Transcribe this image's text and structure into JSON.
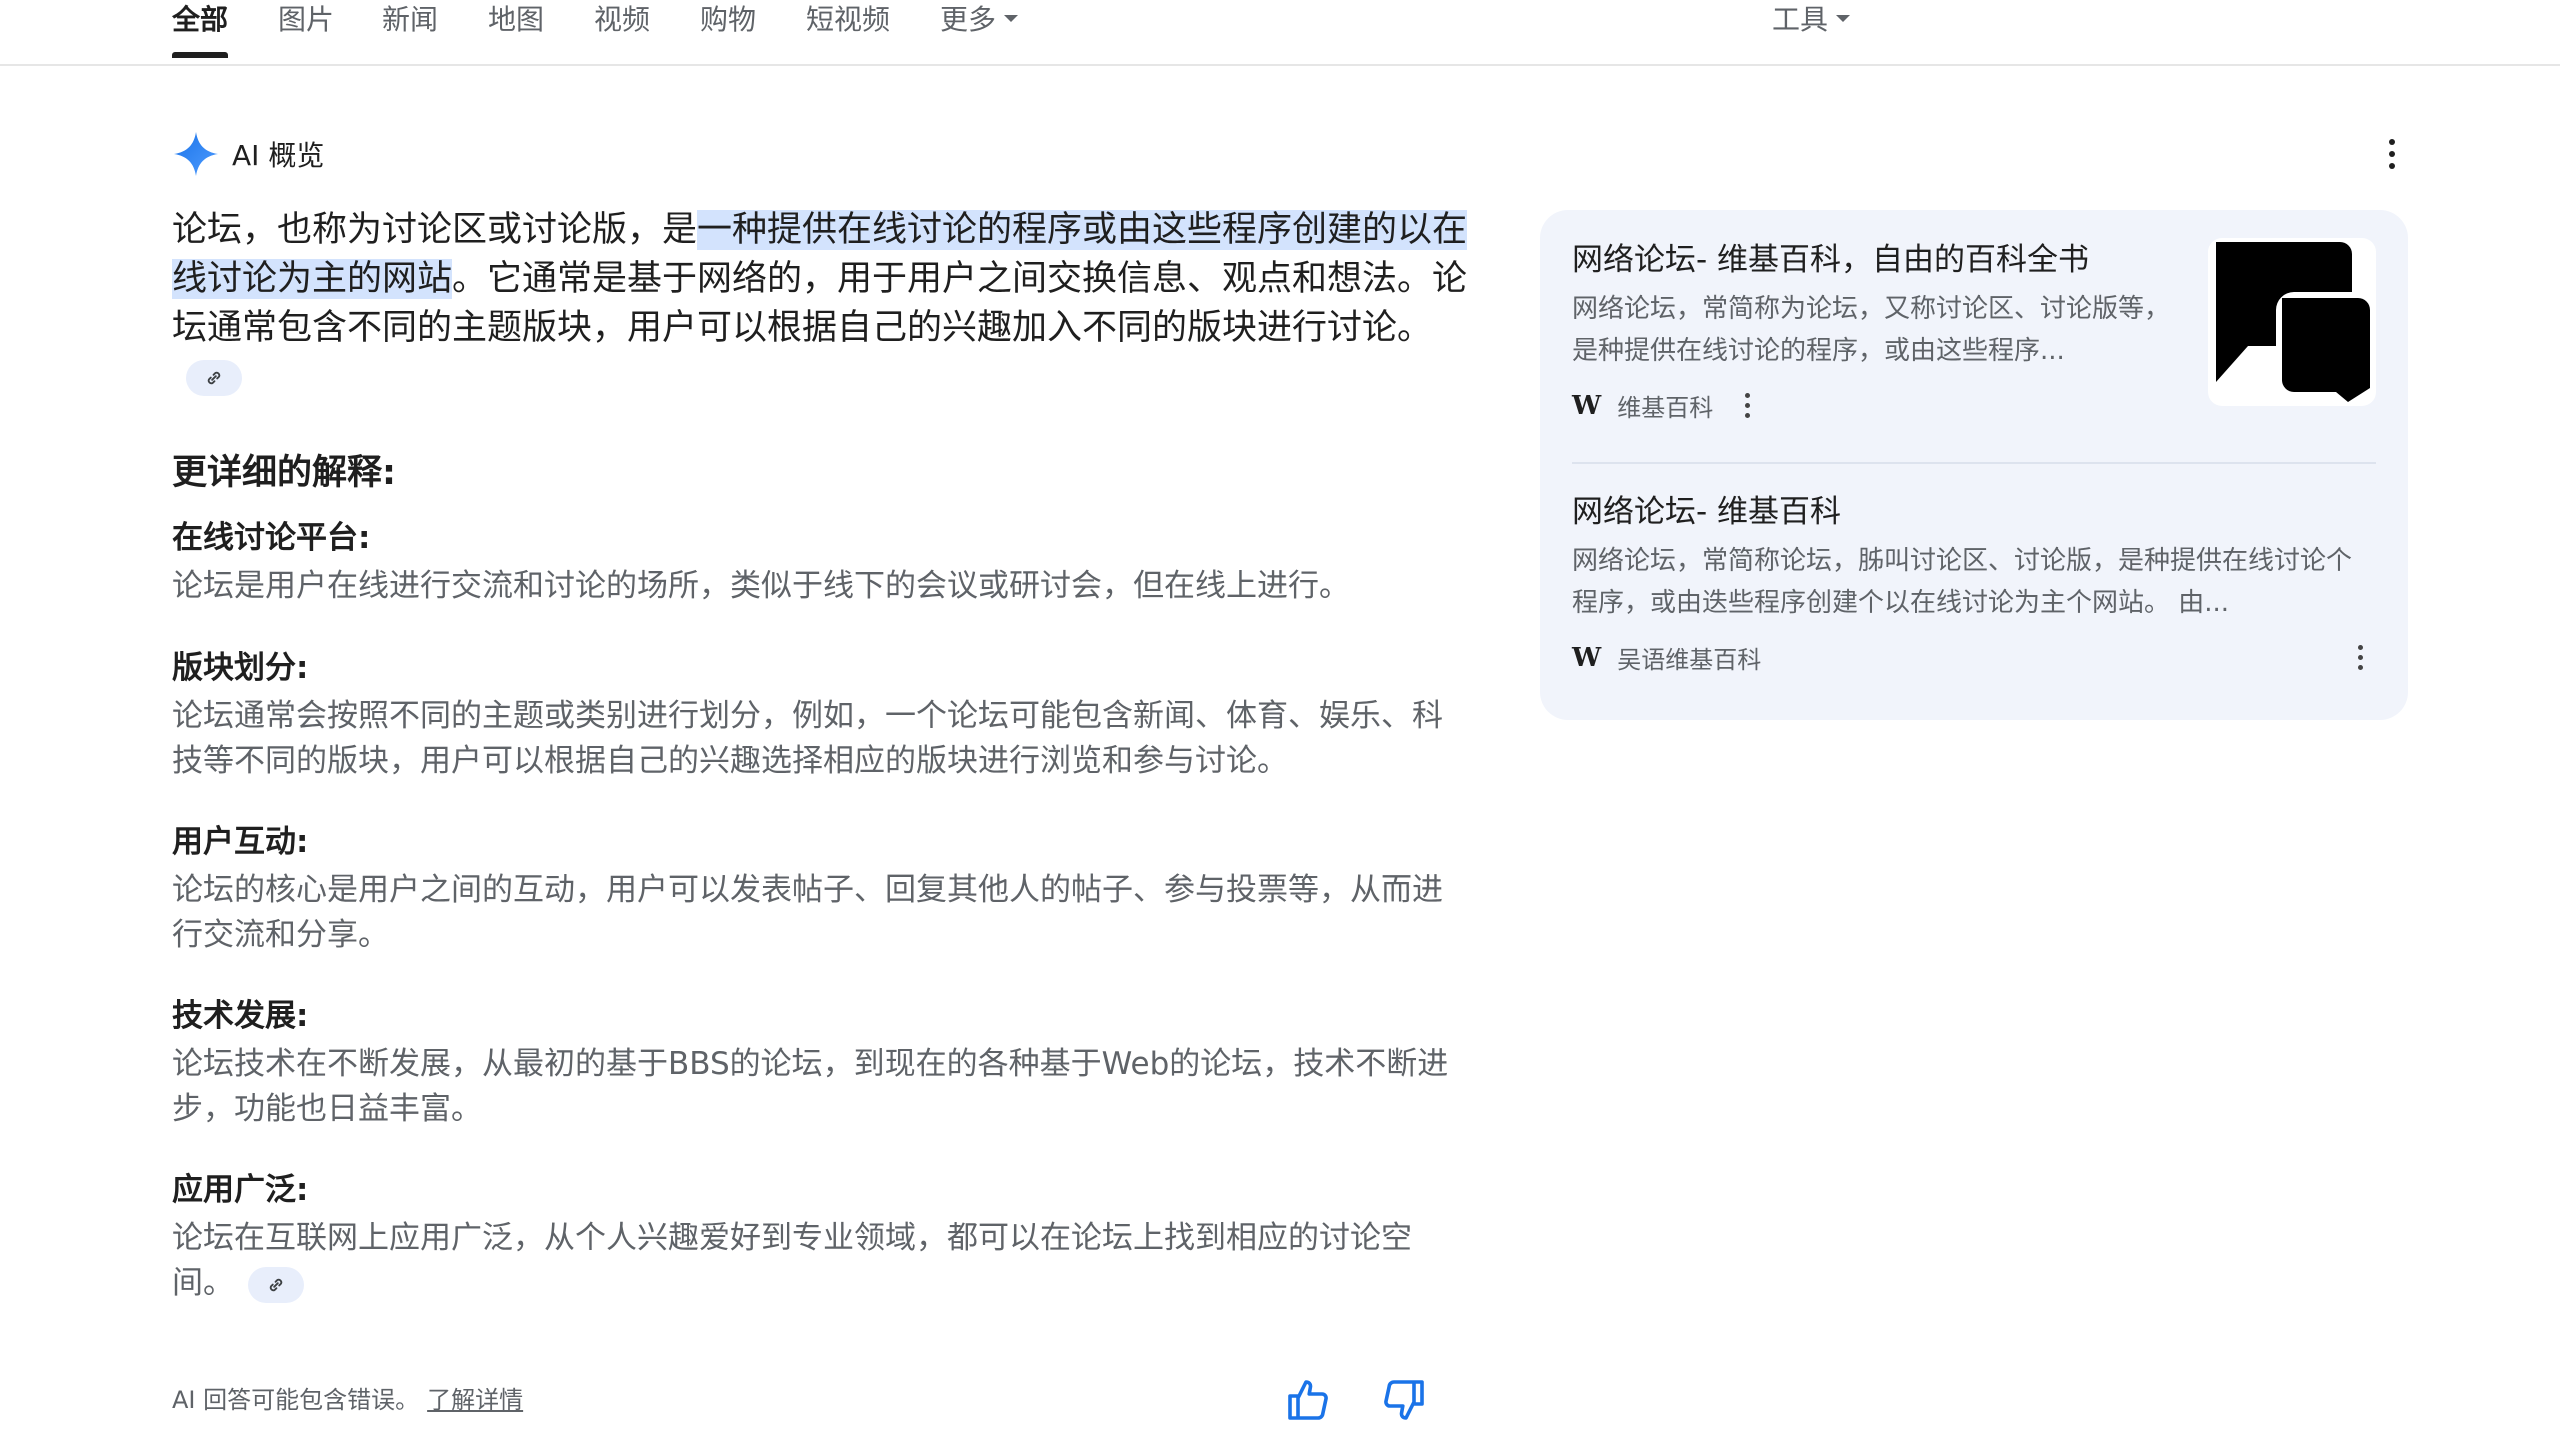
{
  "nav": {
    "tabs": [
      {
        "label": "全部",
        "active": true
      },
      {
        "label": "图片"
      },
      {
        "label": "新闻"
      },
      {
        "label": "地图"
      },
      {
        "label": "视频"
      },
      {
        "label": "购物"
      },
      {
        "label": "短视频"
      },
      {
        "label": "更多"
      }
    ],
    "tools_label": "工具"
  },
  "ai_overview": {
    "title": "AI 概览",
    "summary_pre": "论坛，也称为讨论区或讨论版，是",
    "summary_highlight": "一种提供在线讨论的程序或由这些程序创建的以在线讨论为主的网站",
    "summary_post": "。它通常是基于网络的，用于用户之间交换信息、观点和想法。论坛通常包含不同的主题版块，用户可以根据自己的兴趣加入不同的版块进行讨论。",
    "detail_heading": "更详细的解释:",
    "sections": [
      {
        "title": "在线讨论平台:",
        "body": "论坛是用户在线进行交流和讨论的场所，类似于线下的会议或研讨会，但在线上进行。"
      },
      {
        "title": "版块划分:",
        "body": "论坛通常会按照不同的主题或类别进行划分，例如，一个论坛可能包含新闻、体育、娱乐、科技等不同的版块，用户可以根据自己的兴趣选择相应的版块进行浏览和参与讨论。"
      },
      {
        "title": "用户互动:",
        "body": "论坛的核心是用户之间的互动，用户可以发表帖子、回复其他人的帖子、参与投票等，从而进行交流和分享。"
      },
      {
        "title": "技术发展:",
        "body": "论坛技术在不断发展，从最初的基于BBS的论坛，到现在的各种基于Web的论坛，技术不断进步，功能也日益丰富。"
      },
      {
        "title": "应用广泛:",
        "body": "论坛在互联网上应用广泛，从个人兴趣爱好到专业领域，都可以在论坛上找到相应的讨论空间。"
      }
    ],
    "footer_note": "AI 回答可能包含错误。",
    "footer_link": "了解详情"
  },
  "sources": [
    {
      "title": "网络论坛- 维基百科，自由的百科全书",
      "snippet": "网络论坛，常简称为论坛，又称讨论区、讨论版等，是种提供在线讨论的程序，或由这些程序...",
      "site": "维基百科",
      "logo": "W"
    },
    {
      "title": "网络论坛- 维基百科",
      "snippet": "网络论坛，常简称论坛，胏叫讨论区、讨论版，是种提供在线讨论个程序，或由迭些程序创建个以在线讨论为主个网站。 由...",
      "site": "吴语维基百科",
      "logo": "W"
    }
  ],
  "colors": {
    "highlight": "#d3e3fd",
    "panel_bg": "#f1f4fb",
    "sparkle": "#4285f4",
    "thumb_icon": "#1a73e8"
  },
  "icons": [
    "sparkle-icon",
    "link-icon",
    "more-vert-icon",
    "thumb-up-icon",
    "thumb-down-icon",
    "wikipedia-logo",
    "chat-bubbles-icon"
  ]
}
